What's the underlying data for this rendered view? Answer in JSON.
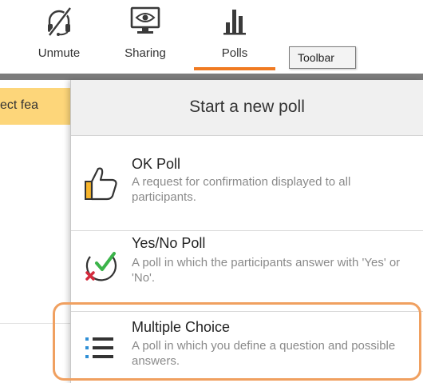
{
  "toolbar": {
    "unmute_label": "Unmute",
    "sharing_label": "Sharing",
    "polls_label": "Polls",
    "tooltip": "Toolbar"
  },
  "banner": {
    "text": "ect fea"
  },
  "panel": {
    "title": "Start a new poll",
    "items": [
      {
        "title": "OK Poll",
        "desc": "A request for confirmation displayed to all participants.",
        "icon": "thumbs-up-icon"
      },
      {
        "title": "Yes/No Poll",
        "desc": "A poll in which the participants answer with 'Yes' or 'No'.",
        "icon": "check-cross-icon"
      },
      {
        "title": "Multiple Choice",
        "desc": "A poll in which you define a question and possible answers.",
        "icon": "list-icon"
      }
    ]
  },
  "colors": {
    "accent": "#f07a22",
    "highlight": "#f0a060",
    "banner": "#fdd67a",
    "check": "#3cb44a",
    "cross": "#d42a3c",
    "list": "#2f8fd6"
  }
}
